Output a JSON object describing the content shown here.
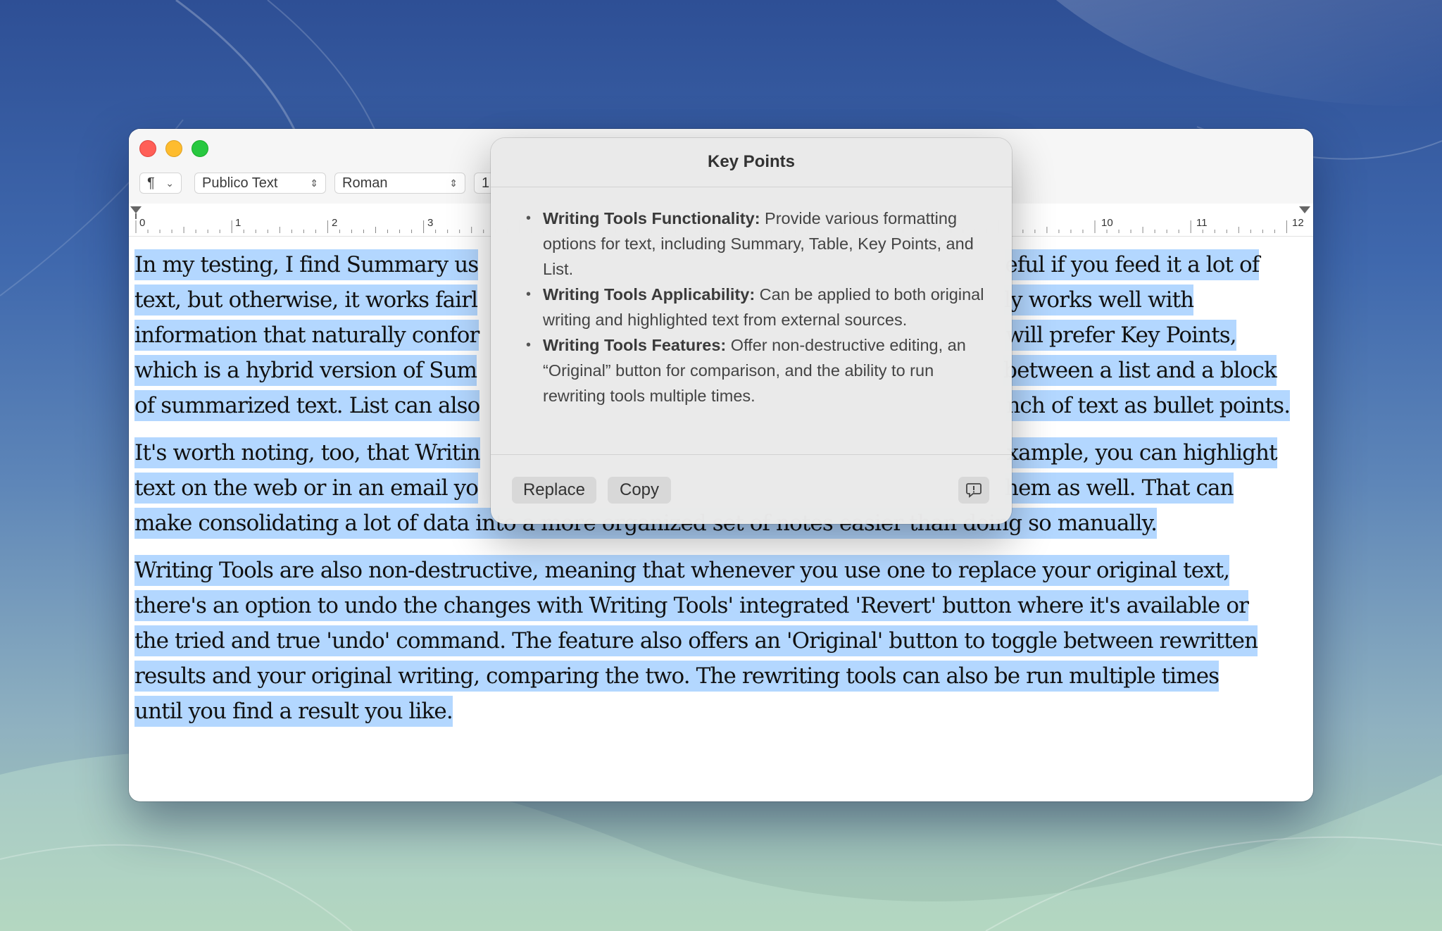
{
  "toolbar": {
    "paragraph_symbol": "¶",
    "font_family": "Publico Text",
    "font_style": "Roman",
    "font_size_partial": "1"
  },
  "ruler": {
    "labels": [
      "0",
      "1",
      "2",
      "3",
      "10",
      "11",
      "12"
    ]
  },
  "document": {
    "paragraphs": [
      [
        "In my testing, I find Summary us",
        "eful if you feed it a lot of",
        "text, but otherwise, it works fairl",
        "ly works well with",
        "information that naturally confor",
        "will prefer Key Points,",
        "which is a hybrid version of Sum",
        "between a list and a block",
        "of summarized text. List can also",
        "nch of text as bullet points."
      ],
      [
        "It's worth noting, too, that Writin",
        "xample, you can highlight",
        "text on the web or in an email yo",
        "hem as well. That can",
        "make consolidating a lot of data into a more organized set of notes easier than doing so manually."
      ],
      [
        "Writing Tools are also non-destructive, meaning that whenever you use one to replace your original text,",
        "there's an option to undo the changes with Writing Tools' integrated 'Revert' button where it's available or",
        "the tried and true 'undo' command. The feature also offers an 'Original' button to toggle between rewritten",
        "results and your original writing, comparing the two. The rewriting tools can also be run multiple times",
        "until you find a result you like."
      ]
    ],
    "selection_color": "#b3d7ff"
  },
  "popover": {
    "title": "Key Points",
    "items": [
      {
        "lead": "Writing Tools Functionality:",
        "text": " Provide various formatting options for text, including Summary, Table, Key Points, and List."
      },
      {
        "lead": "Writing Tools Applicability:",
        "text": " Can be applied to both original writing and highlighted text from external sources."
      },
      {
        "lead": "Writing Tools Features:",
        "text": " Offer non-destructive editing, an “Original” button for comparison, and the ability to run rewriting tools multiple times."
      }
    ],
    "buttons": {
      "replace": "Replace",
      "copy": "Copy"
    },
    "feedback_icon": "feedback-icon"
  },
  "colors": {
    "close": "#ff5f57",
    "minimize": "#febc2e",
    "maximize": "#28c840"
  }
}
